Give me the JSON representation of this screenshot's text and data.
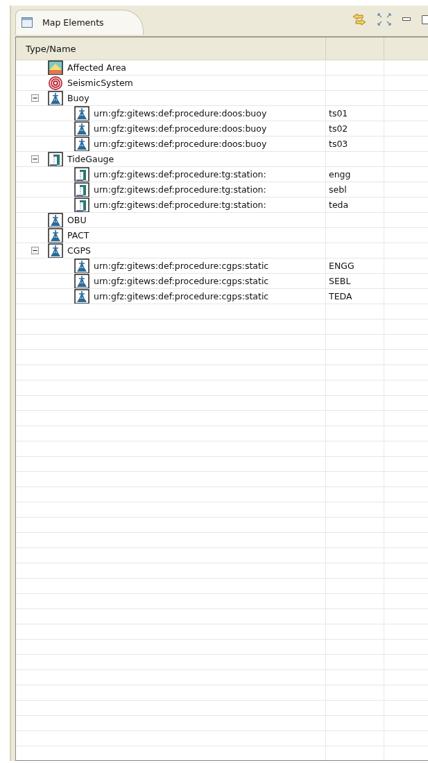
{
  "view": {
    "title": "Map Elements"
  },
  "table": {
    "columns": [
      {
        "label": "Type/Name"
      }
    ],
    "rows": [
      {
        "name": "Affected Area",
        "kind": "area"
      },
      {
        "name": "SeismicSystem",
        "kind": "seismic"
      },
      {
        "name": "Buoy",
        "kind": "buoy",
        "expanded": true,
        "children": [
          {
            "name": "urn:gfz:gitews:def:procedure:doos:buoy",
            "column_2": "ts01",
            "kind": "buoy"
          },
          {
            "name": "urn:gfz:gitews:def:procedure:doos:buoy",
            "column_2": "ts02",
            "kind": "buoy"
          },
          {
            "name": "urn:gfz:gitews:def:procedure:doos:buoy",
            "column_2": "ts03",
            "kind": "buoy"
          }
        ]
      },
      {
        "name": "TideGauge",
        "kind": "tide",
        "expanded": true,
        "children": [
          {
            "name": "urn:gfz:gitews:def:procedure:tg:station:",
            "column_2": "engg",
            "kind": "tide"
          },
          {
            "name": "urn:gfz:gitews:def:procedure:tg:station:",
            "column_2": "sebl",
            "kind": "tide"
          },
          {
            "name": "urn:gfz:gitews:def:procedure:tg:station:",
            "column_2": "teda",
            "kind": "tide"
          }
        ]
      },
      {
        "name": "OBU",
        "kind": "buoy"
      },
      {
        "name": "PACT",
        "kind": "buoy"
      },
      {
        "name": "CGPS",
        "kind": "buoy",
        "expanded": true,
        "children": [
          {
            "name": "urn:gfz:gitews:def:procedure:cgps:static",
            "column_2": "ENGG",
            "kind": "buoy"
          },
          {
            "name": "urn:gfz:gitews:def:procedure:cgps:static",
            "column_2": "SEBL",
            "kind": "buoy"
          },
          {
            "name": "urn:gfz:gitews:def:procedure:cgps:static",
            "column_2": "TEDA",
            "kind": "buoy"
          }
        ]
      }
    ]
  }
}
